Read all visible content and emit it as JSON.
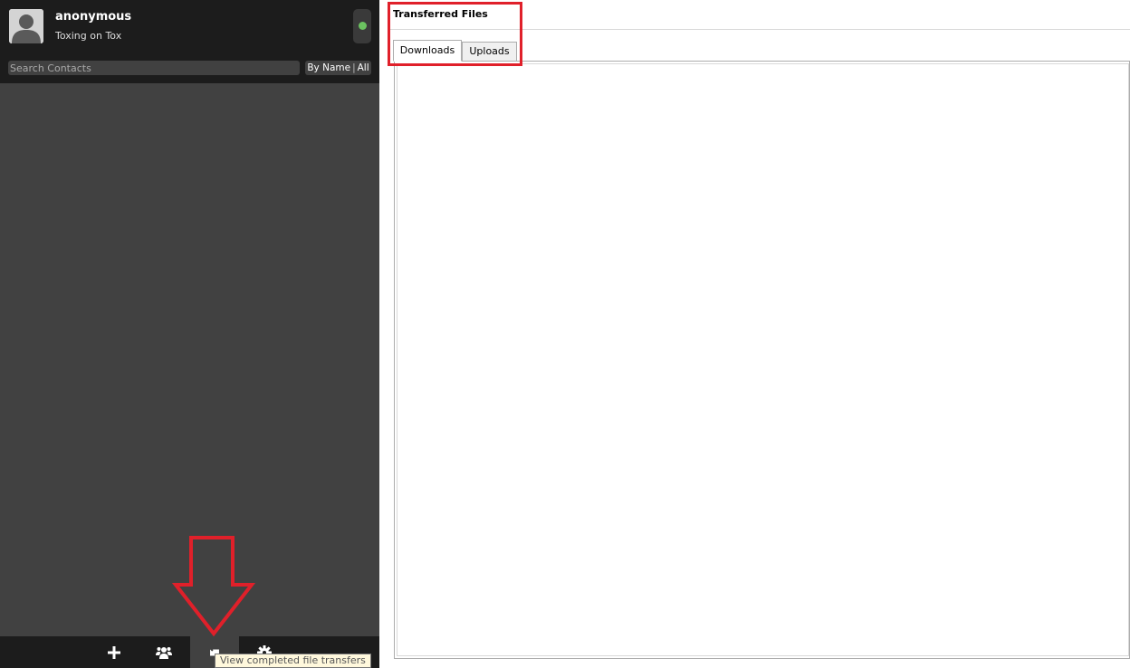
{
  "profile": {
    "username": "anonymous",
    "status_message": "Toxing on Tox",
    "status": "online",
    "status_color": "#6bc260"
  },
  "search": {
    "placeholder": "Search Contacts",
    "value": ""
  },
  "filter": {
    "sort_label": "By Name",
    "separator": "|",
    "scope_label": "All"
  },
  "toolbar": {
    "items": [
      {
        "icon": "plus-icon",
        "action": "add-friend"
      },
      {
        "icon": "group-icon",
        "action": "create-group"
      },
      {
        "icon": "transfer-icon",
        "action": "file-transfers",
        "active": true
      },
      {
        "icon": "gear-icon",
        "action": "settings"
      }
    ],
    "tooltip": "View completed file transfers"
  },
  "main": {
    "title": "Transferred Files",
    "tabs": [
      {
        "label": "Downloads",
        "selected": true
      },
      {
        "label": "Uploads",
        "selected": false
      }
    ]
  },
  "annotations": {
    "highlight_color": "#e0202a"
  },
  "theme": {
    "sidebar_dark": "#1c1c1c",
    "sidebar_mid": "#414141"
  }
}
